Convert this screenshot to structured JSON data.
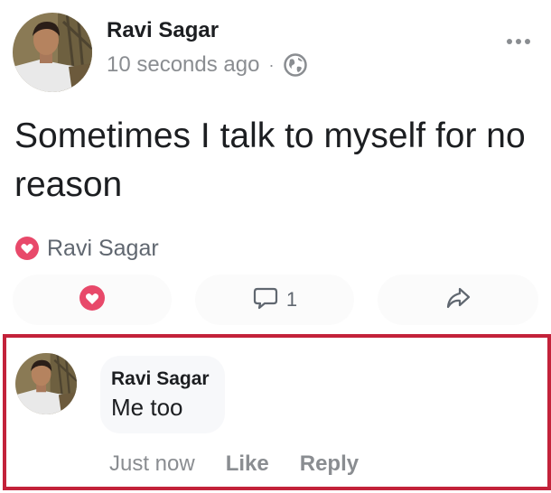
{
  "post": {
    "author_name": "Ravi Sagar",
    "timestamp": "10 seconds ago",
    "separator": "·",
    "privacy_icon": "globe-icon",
    "more_icon": "more-horizontal-icon",
    "text": "Sometimes I talk to myself for no reason"
  },
  "reactions": {
    "icon": "heart-reaction-icon",
    "reactor_name": "Ravi Sagar"
  },
  "actions": {
    "like_icon": "heart-icon",
    "comment_icon": "comment-icon",
    "comment_count": "1",
    "share_icon": "share-arrow-icon"
  },
  "comment": {
    "author_name": "Ravi Sagar",
    "text": "Me too",
    "time": "Just now",
    "like_label": "Like",
    "reply_label": "Reply"
  },
  "colors": {
    "heart": "#e8496a",
    "highlight_border": "#c3223a",
    "muted_text": "#8a8d91",
    "primary_text": "#1c1e21"
  }
}
